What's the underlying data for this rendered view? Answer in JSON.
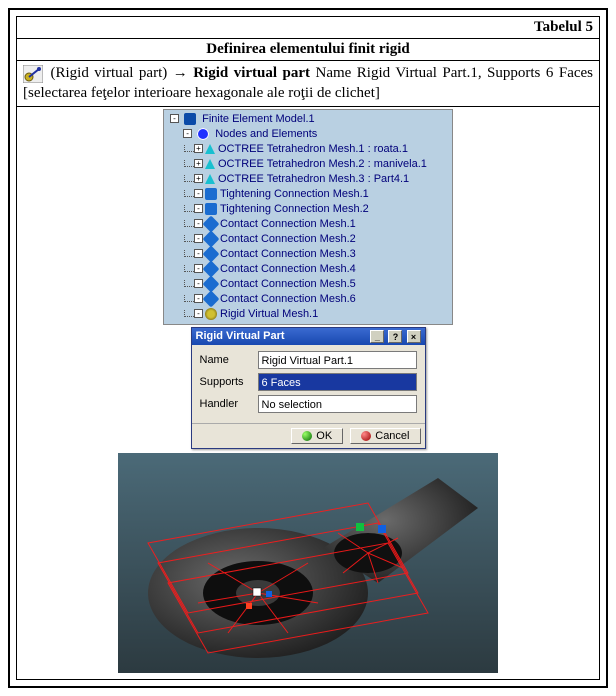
{
  "table": {
    "label": "Tabelul 5",
    "title": "Definirea elementului finit rigid"
  },
  "instruction": {
    "lead": "(Rigid virtual part) → ",
    "bold": "Rigid virtual part",
    "rest": "Name Rigid Virtual Part.1, Supports 6 Faces [selectarea feţelor interioare hexagonale ale roţii de clichet]"
  },
  "tree": {
    "root": "Finite Element Model.1",
    "nodes": "Nodes and Elements",
    "items": [
      "OCTREE Tetrahedron Mesh.1 : roata.1",
      "OCTREE Tetrahedron Mesh.2 : manivela.1",
      "OCTREE Tetrahedron Mesh.3 : Part4.1",
      "Tightening Connection Mesh.1",
      "Tightening Connection Mesh.2",
      "Contact Connection Mesh.1",
      "Contact Connection Mesh.2",
      "Contact Connection Mesh.3",
      "Contact Connection Mesh.4",
      "Contact Connection Mesh.5",
      "Contact Connection Mesh.6",
      "Rigid Virtual Mesh.1"
    ]
  },
  "dialog": {
    "title": "Rigid Virtual Part",
    "name_label": "Name",
    "name_value": "Rigid Virtual Part.1",
    "supports_label": "Supports",
    "supports_value": "6 Faces",
    "handler_label": "Handler",
    "handler_value": "No selection",
    "ok": "OK",
    "cancel": "Cancel"
  }
}
